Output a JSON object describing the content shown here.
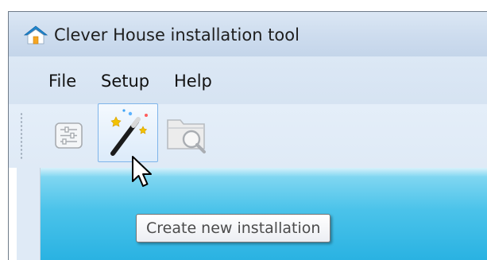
{
  "window": {
    "title": "Clever House installation tool",
    "title_icon": "house-icon"
  },
  "menu": {
    "items": [
      {
        "label": "File"
      },
      {
        "label": "Setup"
      },
      {
        "label": "Help"
      }
    ]
  },
  "toolbar": {
    "buttons": [
      {
        "icon": "settings-sliders-icon",
        "state": "normal"
      },
      {
        "icon": "magic-wand-icon",
        "state": "hover"
      },
      {
        "icon": "folder-search-icon",
        "state": "disabled"
      }
    ]
  },
  "tooltip": {
    "text": "Create new installation"
  },
  "colors": {
    "titlebar": "#cddcee",
    "menubar": "#d6e3f2",
    "toolbar": "#e4eef9",
    "content_gradient_top": "#7fd6f1",
    "content_gradient_bottom": "#29b2e2",
    "hover_border": "#7eb4ea",
    "house_roof": "#1f8fd6",
    "house_door": "#f5a623"
  }
}
